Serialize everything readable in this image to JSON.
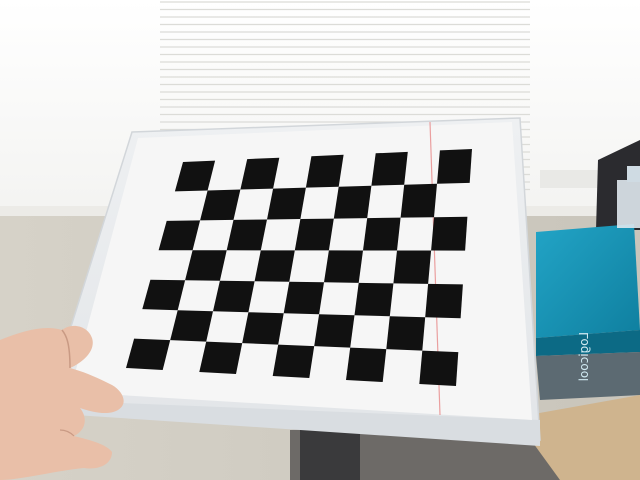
{
  "scene": {
    "description_free": true,
    "board": {
      "rows": 7,
      "cols": 9,
      "first_square_dark": true
    },
    "printed_logo_text": "Logicool"
  },
  "colors": {
    "window_glow": "#ffffff",
    "wall": "#dcd8cf",
    "blinds": "#f7f7f5",
    "paper": "#f4f4f4",
    "sleeve_edge": "#e6e8ea",
    "square_dark": "#111111",
    "box_blue": "#1a8fb0",
    "desk_wood": "#cfb48e",
    "skin": "#e9bfa8",
    "monitor": "#2b2b2f"
  }
}
